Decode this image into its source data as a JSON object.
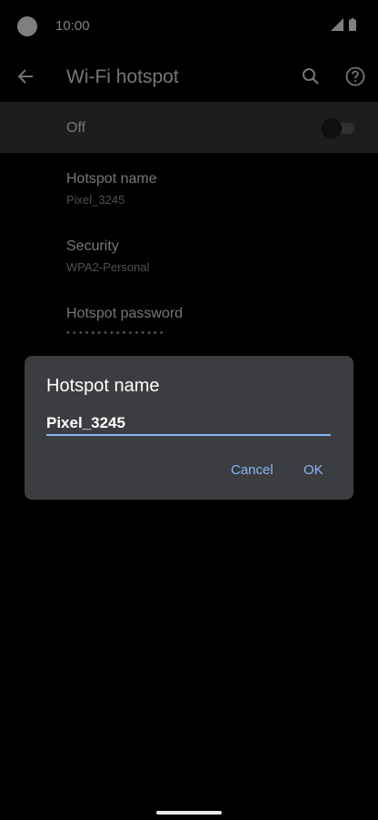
{
  "status_bar": {
    "time": "10:00"
  },
  "appbar": {
    "title": "Wi-Fi hotspot"
  },
  "toggle": {
    "label": "Off",
    "enabled": false
  },
  "prefs": [
    {
      "title": "Hotspot name",
      "subtitle": "Pixel_3245"
    },
    {
      "title": "Security",
      "subtitle": "WPA2-Personal"
    },
    {
      "title": "Hotspot password",
      "subtitle": "••••••••••••••••"
    }
  ],
  "dialog": {
    "title": "Hotspot name",
    "value": "Pixel_3245",
    "cancel_label": "Cancel",
    "ok_label": "OK"
  },
  "colors": {
    "accent": "#8ab4f8",
    "dialog_bg": "#3c3d40",
    "toggle_row_bg": "#3a3a3a"
  },
  "icons": [
    "camera-cutout",
    "wifi-icon",
    "battery-icon",
    "back-arrow-icon",
    "search-icon",
    "help-icon"
  ]
}
